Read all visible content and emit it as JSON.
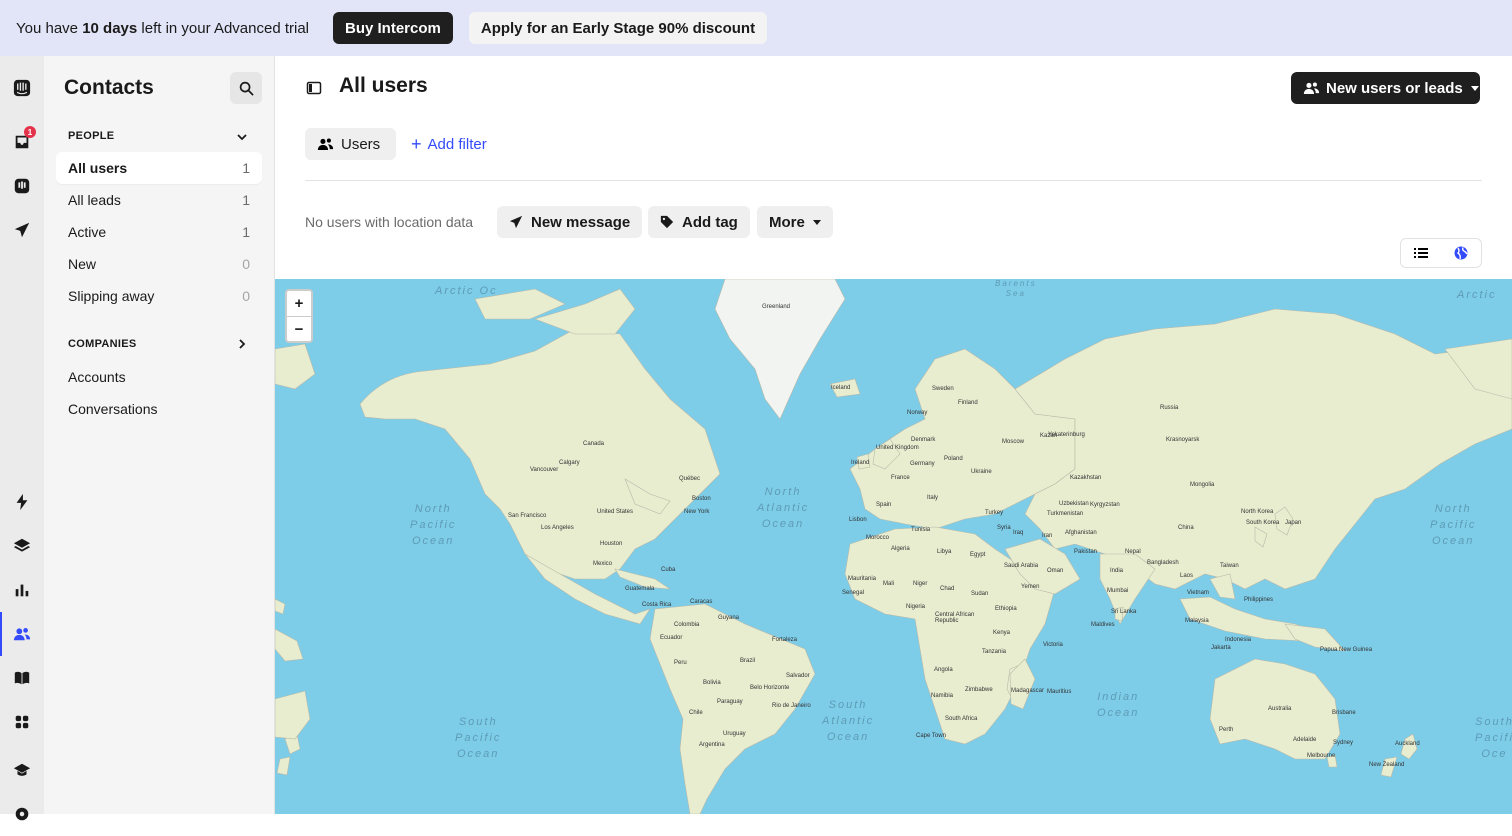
{
  "banner": {
    "prefix": "You have ",
    "days": "10 days",
    "suffix": " left in your Advanced trial",
    "buy_label": "Buy Intercom",
    "discount_label": "Apply for an Early Stage 90% discount"
  },
  "rail": {
    "inbox_badge": "1"
  },
  "sidebar": {
    "title": "Contacts",
    "people_section": "PEOPLE",
    "people_items": [
      {
        "label": "All users",
        "count": "1"
      },
      {
        "label": "All leads",
        "count": "1"
      },
      {
        "label": "Active",
        "count": "1"
      },
      {
        "label": "New",
        "count": "0"
      },
      {
        "label": "Slipping away",
        "count": "0"
      }
    ],
    "companies_section": "COMPANIES",
    "company_items": [
      {
        "label": "Accounts"
      },
      {
        "label": "Conversations"
      }
    ]
  },
  "main": {
    "title": "All users",
    "new_button_label": "New users or leads",
    "filter_chip_label": "Users",
    "add_filter_label": "Add filter",
    "no_location_text": "No users with location data",
    "actions": {
      "new_message": "New message",
      "add_tag": "Add tag",
      "more": "More"
    }
  },
  "map": {
    "zoom_in": "+",
    "zoom_out": "−",
    "oceans": {
      "north_pacific_left": "North\nPacific\nOcean",
      "north_atlantic": "North\nAtlantic\nOcean",
      "north_pacific_right": "North\nPacific\nOcean",
      "south_pacific_left": "South\nPacific\nOcean",
      "south_atlantic": "South\nAtlantic\nOcean",
      "indian": "Indian\nOcean",
      "south_pacific_right": "South\nPacifi\nOce",
      "arctic_left": "Arctic Oc",
      "arctic_right": "Arctic",
      "barents": "Barents\nSea"
    },
    "places": [
      {
        "name": "Greenland"
      },
      {
        "name": "Iceland"
      },
      {
        "name": "Sweden"
      },
      {
        "name": "Finland"
      },
      {
        "name": "Norway"
      },
      {
        "name": "Russia"
      },
      {
        "name": "Canada"
      },
      {
        "name": "United States"
      },
      {
        "name": "Mexico"
      },
      {
        "name": "Houston"
      },
      {
        "name": "Calgary"
      },
      {
        "name": "Vancouver"
      },
      {
        "name": "San Francisco"
      },
      {
        "name": "Los Angeles"
      },
      {
        "name": "Québec"
      },
      {
        "name": "Boston"
      },
      {
        "name": "New York"
      },
      {
        "name": "Cuba"
      },
      {
        "name": "Guatemala"
      },
      {
        "name": "Costa Rica"
      },
      {
        "name": "Caracas"
      },
      {
        "name": "Colombia"
      },
      {
        "name": "Ecuador"
      },
      {
        "name": "Peru"
      },
      {
        "name": "Brazil"
      },
      {
        "name": "Bolivia"
      },
      {
        "name": "Paraguay"
      },
      {
        "name": "Chile"
      },
      {
        "name": "Argentina"
      },
      {
        "name": "Uruguay"
      },
      {
        "name": "Belo Horizonte"
      },
      {
        "name": "Rio de Janeiro"
      },
      {
        "name": "Salvador"
      },
      {
        "name": "Fortaleza"
      },
      {
        "name": "Guyana"
      },
      {
        "name": "United Kingdom"
      },
      {
        "name": "Ireland"
      },
      {
        "name": "Denmark"
      },
      {
        "name": "Germany"
      },
      {
        "name": "Poland"
      },
      {
        "name": "France"
      },
      {
        "name": "Spain"
      },
      {
        "name": "Italy"
      },
      {
        "name": "Ukraine"
      },
      {
        "name": "Moscow"
      },
      {
        "name": "Kazan"
      },
      {
        "name": "Yekaterinburg"
      },
      {
        "name": "Kazakhstan"
      },
      {
        "name": "Turkey"
      },
      {
        "name": "Syria"
      },
      {
        "name": "Iran"
      },
      {
        "name": "Iraq"
      },
      {
        "name": "Uzbekistan"
      },
      {
        "name": "Turkmenistan"
      },
      {
        "name": "Kyrgyzstan"
      },
      {
        "name": "Afghanistan"
      },
      {
        "name": "Pakistan"
      },
      {
        "name": "India"
      },
      {
        "name": "Nepal"
      },
      {
        "name": "Bangladesh"
      },
      {
        "name": "China"
      },
      {
        "name": "Mongolia"
      },
      {
        "name": "Krasnoyarsk"
      },
      {
        "name": "North Korea"
      },
      {
        "name": "South Korea"
      },
      {
        "name": "Japan"
      },
      {
        "name": "Taiwan"
      },
      {
        "name": "Laos"
      },
      {
        "name": "Vietnam"
      },
      {
        "name": "Philippines"
      },
      {
        "name": "Malaysia"
      },
      {
        "name": "Indonesia"
      },
      {
        "name": "Papua New Guinea"
      },
      {
        "name": "Australia"
      },
      {
        "name": "New Zealand"
      },
      {
        "name": "Sri Lanka"
      },
      {
        "name": "Maldives"
      },
      {
        "name": "Oman"
      },
      {
        "name": "Yemen"
      },
      {
        "name": "Saudi Arabia"
      },
      {
        "name": "Egypt"
      },
      {
        "name": "Libya"
      },
      {
        "name": "Algeria"
      },
      {
        "name": "Morocco"
      },
      {
        "name": "Tunisia"
      },
      {
        "name": "Mali"
      },
      {
        "name": "Niger"
      },
      {
        "name": "Chad"
      },
      {
        "name": "Sudan"
      },
      {
        "name": "Ethiopia"
      },
      {
        "name": "Nigeria"
      },
      {
        "name": "Kenya"
      },
      {
        "name": "Tanzania"
      },
      {
        "name": "Angola"
      },
      {
        "name": "Namibia"
      },
      {
        "name": "Zimbabwe"
      },
      {
        "name": "South Africa"
      },
      {
        "name": "Madagascar"
      },
      {
        "name": "Cape Town"
      },
      {
        "name": "Mauritania"
      },
      {
        "name": "Senegal"
      },
      {
        "name": "Lisbon"
      },
      {
        "name": "Central African Republic"
      },
      {
        "name": "Mumbai"
      },
      {
        "name": "Perth"
      },
      {
        "name": "Adelaide"
      },
      {
        "name": "Melbourne"
      },
      {
        "name": "Sydney"
      },
      {
        "name": "Brisbane"
      },
      {
        "name": "Auckland"
      },
      {
        "name": "Jakarta"
      },
      {
        "name": "Mauritius"
      },
      {
        "name": "Victoria"
      }
    ]
  }
}
